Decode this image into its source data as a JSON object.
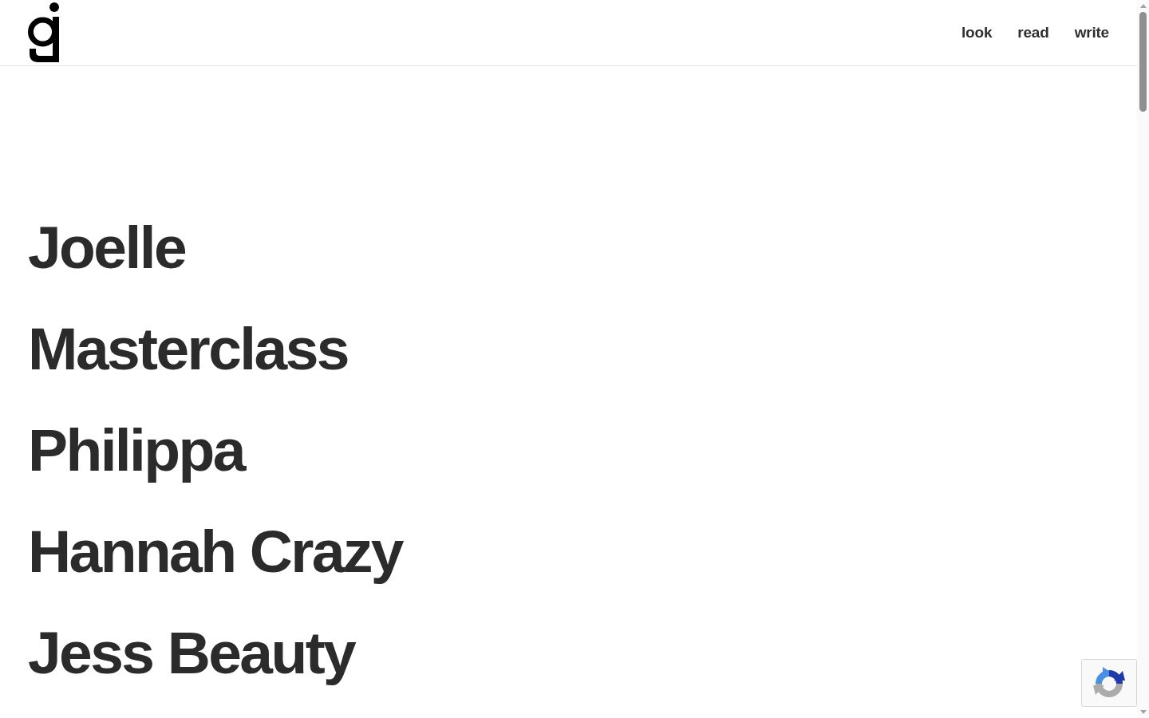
{
  "header": {
    "nav": [
      "look",
      "read",
      "write"
    ]
  },
  "projects": [
    "Joelle",
    "Masterclass",
    "Philippa",
    "Hannah Crazy",
    "Jess Beauty"
  ]
}
